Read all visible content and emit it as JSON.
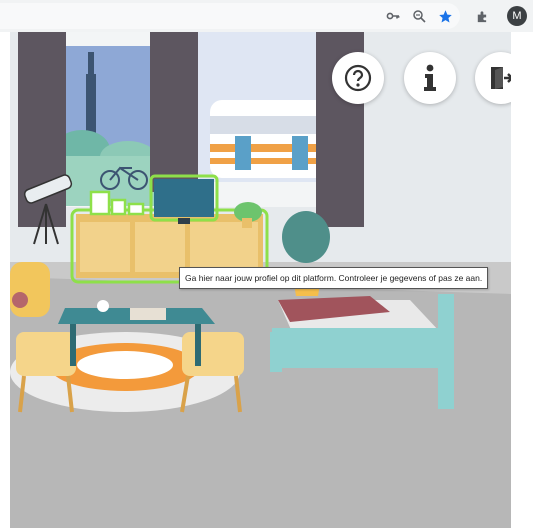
{
  "browser": {
    "icons": [
      "key-icon",
      "zoom-icon",
      "bookmark-star-icon",
      "extension-icon"
    ],
    "profile_initial": "M"
  },
  "room": {
    "buttons": [
      {
        "name": "help-button",
        "icon": "question-mark-icon"
      },
      {
        "name": "info-button",
        "icon": "info-icon"
      },
      {
        "name": "exit-button",
        "icon": "exit-door-icon"
      }
    ],
    "tooltip": "Ga hier naar jouw profiel op dit platform.  Controleer je gegevens of pas ze aan.",
    "colors": {
      "highlight": "#8ee04a",
      "wall": "#e6eaed",
      "floor": "#b7b7b7",
      "curtain": "#5d5660",
      "bed": "#8fd1d0",
      "table": "#3f8a93",
      "cabinet": "#e9c06a"
    }
  }
}
